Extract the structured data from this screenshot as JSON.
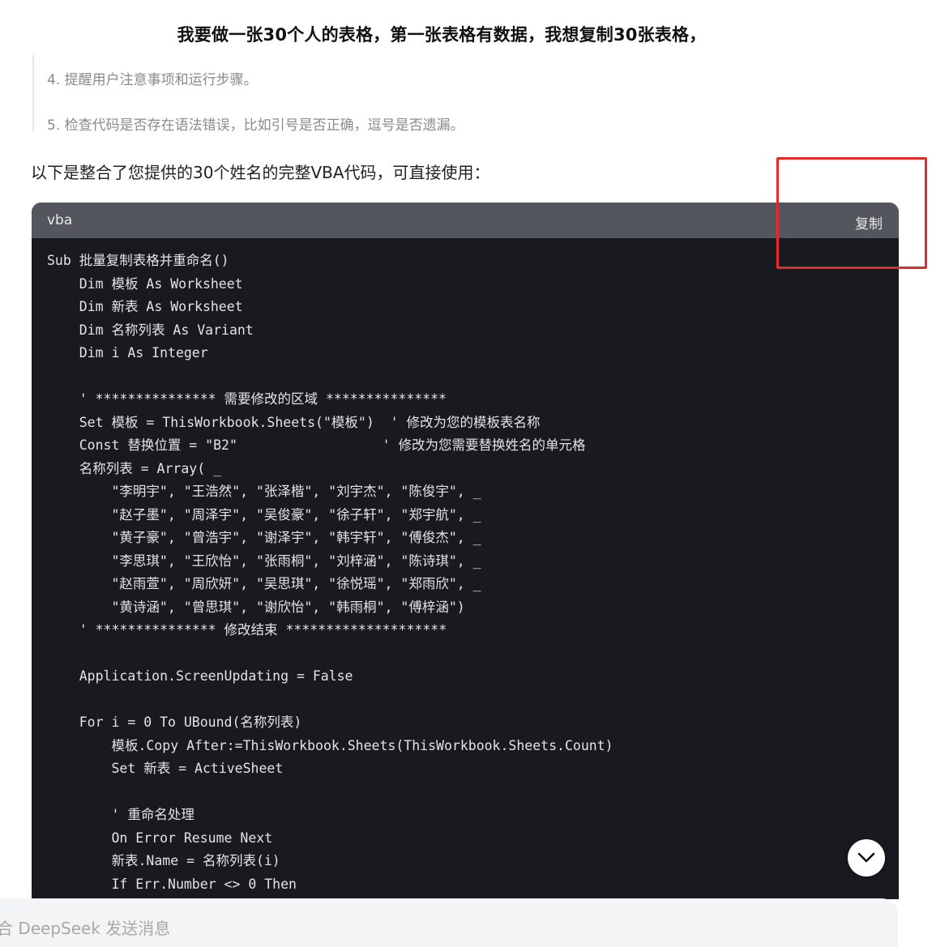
{
  "user_message": "我要做一张30个人的表格，第一张表格有数据，我想复制30张表格，",
  "notes": [
    "4. 提醒用户注意事项和运行步骤。",
    "5. 检查代码是否存在语法错误，比如引号是否正确，逗号是否遗漏。"
  ],
  "intro": "以下是整合了您提供的30个姓名的完整VBA代码，可直接使用：",
  "code_block": {
    "language": "vba",
    "copy_label": "复制",
    "lines": [
      "Sub 批量复制表格并重命名()",
      "    Dim 模板 As Worksheet",
      "    Dim 新表 As Worksheet",
      "    Dim 名称列表 As Variant",
      "    Dim i As Integer",
      "",
      "    ' *************** 需要修改的区域 ***************",
      "    Set 模板 = ThisWorkbook.Sheets(\"模板\")  ' 修改为您的模板表名称",
      "    Const 替换位置 = \"B2\"                  ' 修改为您需要替换姓名的单元格",
      "    名称列表 = Array( _",
      "        \"李明宇\", \"王浩然\", \"张泽楷\", \"刘宇杰\", \"陈俊宇\", _",
      "        \"赵子墨\", \"周泽宇\", \"吴俊豪\", \"徐子轩\", \"郑宇航\", _",
      "        \"黄子豪\", \"曾浩宇\", \"谢泽宇\", \"韩宇轩\", \"傅俊杰\", _",
      "        \"李思琪\", \"王欣怡\", \"张雨桐\", \"刘梓涵\", \"陈诗琪\", _",
      "        \"赵雨萱\", \"周欣妍\", \"吴思琪\", \"徐悦瑶\", \"郑雨欣\", _",
      "        \"黄诗涵\", \"曾思琪\", \"谢欣怡\", \"韩雨桐\", \"傅梓涵\")",
      "    ' *************** 修改结束 ********************",
      "",
      "    Application.ScreenUpdating = False",
      "",
      "    For i = 0 To UBound(名称列表)",
      "        模板.Copy After:=ThisWorkbook.Sheets(ThisWorkbook.Sheets.Count)",
      "        Set 新表 = ActiveSheet",
      "",
      "        ' 重命名处理",
      "        On Error Resume Next",
      "        新表.Name = 名称列表(i)",
      "        If Err.Number <> 0 Then"
    ]
  },
  "scroll_button_icon": "chevron-down-icon",
  "input": {
    "placeholder": "合 DeepSeek 发送消息"
  },
  "colors": {
    "annotation": "#e22b2b",
    "code_background": "#181a20",
    "code_header": "#54565d"
  }
}
